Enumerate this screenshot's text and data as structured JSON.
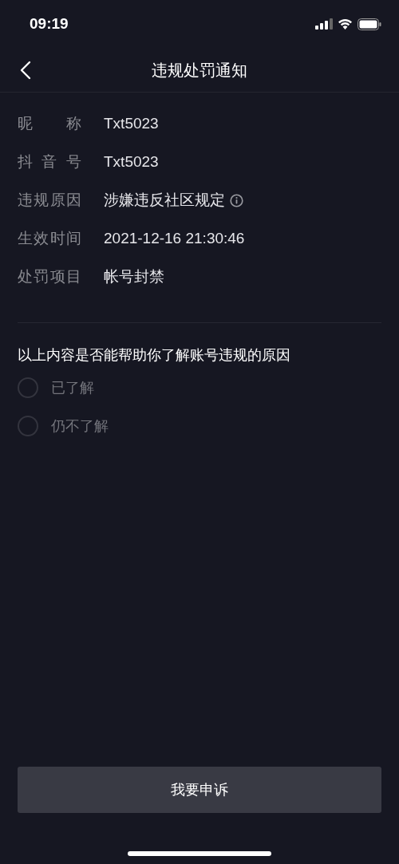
{
  "status_bar": {
    "time": "09:19"
  },
  "nav": {
    "title": "违规处罚通知"
  },
  "details": [
    {
      "label": "昵 称",
      "value": "Txt5023",
      "info": false
    },
    {
      "label": "抖 音 号",
      "value": "Txt5023",
      "info": false
    },
    {
      "label": "违规原因",
      "value": "涉嫌违反社区规定",
      "info": true
    },
    {
      "label": "生效时间",
      "value": "2021-12-16 21:30:46",
      "info": false
    },
    {
      "label": "处罚项目",
      "value": "帐号封禁",
      "info": false
    }
  ],
  "survey": {
    "question": "以上内容是否能帮助你了解账号违规的原因",
    "options": [
      {
        "label": "已了解",
        "selected": false
      },
      {
        "label": "仍不了解",
        "selected": false
      }
    ]
  },
  "appeal_button": "我要申诉"
}
